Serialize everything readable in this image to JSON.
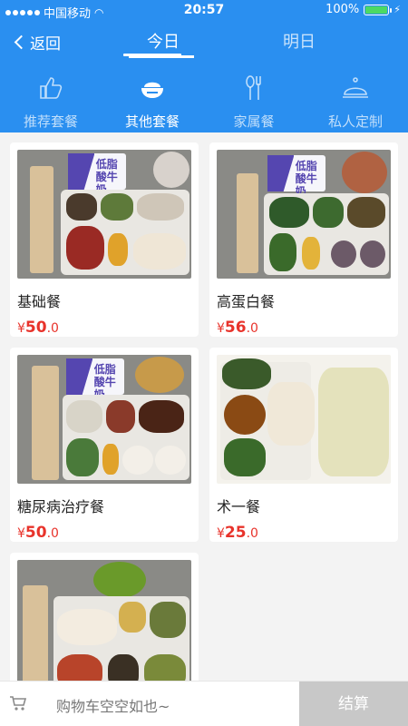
{
  "status_bar": {
    "carrier": "中国移动",
    "time": "20:57",
    "battery": "100%",
    "icons": [
      "signal-icon",
      "wifi-icon",
      "battery-icon",
      "charging-icon"
    ]
  },
  "nav": {
    "back_label": "返回",
    "tabs": [
      {
        "label": "今日",
        "active": true
      },
      {
        "label": "明日",
        "active": false
      }
    ]
  },
  "categories": [
    {
      "label": "推荐套餐",
      "icon": "thumbs-up-icon",
      "active": false
    },
    {
      "label": "其他套餐",
      "icon": "rice-bowl-icon",
      "active": true
    },
    {
      "label": "家属餐",
      "icon": "spoon-fork-icon",
      "active": false
    },
    {
      "label": "私人定制",
      "icon": "cloche-icon",
      "active": false
    }
  ],
  "meals": [
    {
      "name": "基础餐",
      "currency": "¥",
      "price_main": "50",
      "price_decimal": ".0"
    },
    {
      "name": "高蛋白餐",
      "currency": "¥",
      "price_main": "56",
      "price_decimal": ".0"
    },
    {
      "name": "糖尿病治疗餐",
      "currency": "¥",
      "price_main": "50",
      "price_decimal": ".0"
    },
    {
      "name": "术一餐",
      "currency": "¥",
      "price_main": "25",
      "price_decimal": ".0"
    },
    {
      "name": "",
      "currency": "",
      "price_main": "",
      "price_decimal": ""
    }
  ],
  "milk_label": {
    "line1": "低脂",
    "line2": "酸牛奶"
  },
  "footer": {
    "cart_text": "购物车空空如也~",
    "checkout_label": "结算"
  },
  "colors": {
    "brand_blue": "#2a8ff0",
    "price_red": "#e8332b",
    "checkout_gray": "#c8c8c8"
  }
}
